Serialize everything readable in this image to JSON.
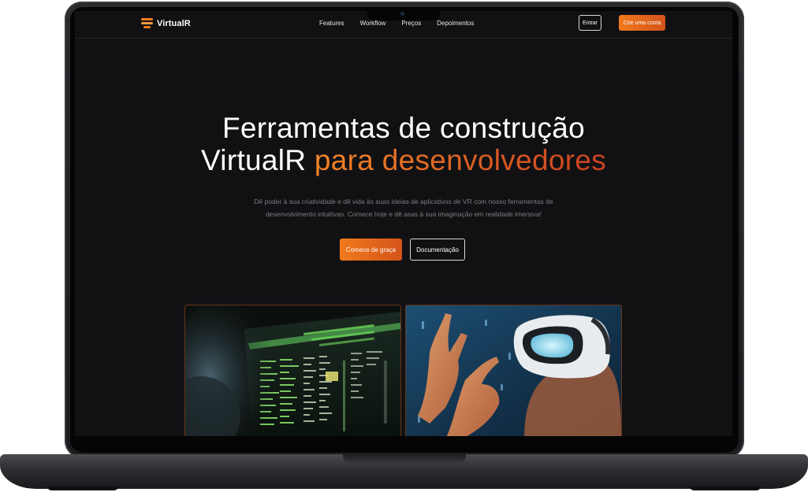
{
  "brand": {
    "name": "VirtualR",
    "accent_color": "#f07a1c",
    "accent_color_dark": "#c9421f"
  },
  "nav": {
    "links": [
      "Features",
      "Workflow",
      "Preços",
      "Depoimentos"
    ],
    "login_label": "Entrar",
    "signup_label": "Crie uma conta"
  },
  "hero": {
    "title_line1": "Ferramentas de construção",
    "title_line2_plain": "VirtualR ",
    "title_line2_accent": "para desenvolvedores",
    "subtitle": "Dê poder à sua criatividade e dê vida às suas ideias de aplicativos de VR com nosso ferramentas de desenvolvimento intuitivas. Comece hoje e dê asas à sua imaginação em realidade imersiva!",
    "primary_cta": "Comece de graça",
    "secondary_cta": "Documentação"
  },
  "media": {
    "left_image": "code-editor-screen-photo",
    "right_image": "vr-headset-person-photo"
  },
  "icons": {
    "logo": "stacked-bars-logo-icon"
  }
}
